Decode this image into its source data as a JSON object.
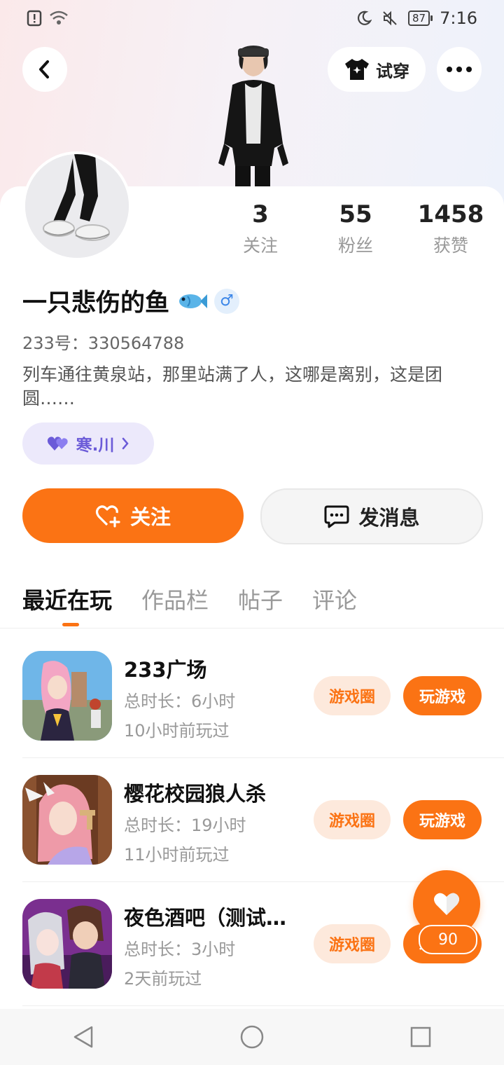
{
  "status_bar": {
    "time": "7:16",
    "battery": "87"
  },
  "header": {
    "tryon_label": "试穿"
  },
  "stats": [
    {
      "value": "3",
      "label": "关注"
    },
    {
      "value": "55",
      "label": "粉丝"
    },
    {
      "value": "1458",
      "label": "获赞"
    }
  ],
  "profile": {
    "name": "一只悲伤的鱼",
    "gender_symbol": "♂",
    "uid": "233号：330564788",
    "bio": "列车通往黄泉站，那里站满了人，这哪是离别，这是团圆……",
    "tag": "寒.川"
  },
  "actions": {
    "follow": "关注",
    "message": "发消息"
  },
  "tabs": [
    "最近在玩",
    "作品栏",
    "帖子",
    "评论"
  ],
  "games": [
    {
      "title": "233广场",
      "duration": "总时长：6小时",
      "last_played": "10小时前玩过",
      "circle": "游戏圈",
      "play": "玩游戏"
    },
    {
      "title": "樱花校园狼人杀",
      "duration": "总时长：19小时",
      "last_played": "11小时前玩过",
      "circle": "游戏圈",
      "play": "玩游戏"
    },
    {
      "title": "夜色酒吧（测试…",
      "duration": "总时长：3小时",
      "last_played": "2天前玩过",
      "circle": "游戏圈",
      "play": "玩游戏"
    }
  ],
  "like_fab": {
    "count": "90"
  },
  "colors": {
    "accent": "#fb7314",
    "tag_purple": "#6b5bd8"
  }
}
